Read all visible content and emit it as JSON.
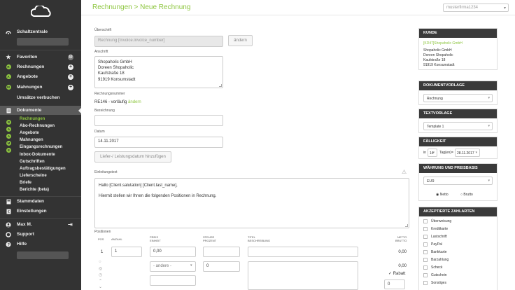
{
  "sidebar": {
    "main": "Schaltzentrale",
    "favorites": "Favoriten",
    "invoices": "Rechnungen",
    "offers": "Angebote",
    "reminders": "Mahnungen",
    "post_revenue": "Umsätze verbuchen",
    "documents": "Dokumente",
    "doc_items": [
      "Rechnungen",
      "Abo-Rechnungen",
      "Angebote",
      "Mahnungen",
      "Eingangsrechnungen",
      "Inbox-Dokumente",
      "Gutschriften",
      "Auftragsbestätigungen",
      "Lieferscheine",
      "Briefe",
      "Berichte (beta)"
    ],
    "master_data": "Stammdaten",
    "settings": "Einstellungen",
    "user": "Max M.",
    "support": "Support",
    "help": "Hilfe"
  },
  "header": {
    "title": "Rechnungen > Neue Rechnung",
    "account": "musterfirma1234"
  },
  "form": {
    "subject_label": "Überschrift",
    "subject_value": "Rechnung [Invoice.invoice_number]",
    "change_btn": "ändern",
    "address_label": "Anschrift",
    "address_lines": [
      "Shopaholic GmbH",
      "Doreen Shopaholic",
      "Kaufstraße 18",
      "91919 Konsumstadt"
    ],
    "invoice_number_label": "Rechnungsnummer",
    "invoice_number_value": "RE146 - vorläufig",
    "invoice_number_change": "ändern",
    "designation_label": "Bezeichnung",
    "date_label": "Datum",
    "date_value": "14.11.2017",
    "delivery_btn": "Liefer-/ Leistungsdatum hinzufügen",
    "intro_label": "Einleitungstext",
    "intro_text": [
      "Hallo [Client.salutation] [Client.last_name],",
      "Hiermit stellen wir Ihnen die folgenden Positionen in Rechnung."
    ]
  },
  "positions": {
    "label": "Positionen",
    "headers": {
      "pos": "POS",
      "qty": "ANZAHL",
      "price": [
        "PREIS",
        "EINHEIT"
      ],
      "tax": [
        "STEUER",
        "PROZENT"
      ],
      "title": [
        "TITEL",
        "BESCHREIBUNG"
      ],
      "net": [
        "NETTO",
        "BRUTTO"
      ]
    },
    "row": {
      "pos": "1",
      "qty": "1",
      "price": "0,00",
      "unit": "- andere -",
      "tax": "0",
      "net": "0,00",
      "gross": "0,00",
      "discount_label": "Rabatt",
      "discount_value": "0"
    }
  },
  "panels": {
    "customer": {
      "title": "KUNDE",
      "link": "[KD47]Shopaholic GmbH",
      "lines": [
        "Shopaholic GmbH",
        "Doreen Shopaholic",
        "Kaufstraße 18",
        "91919 Konsumstadt"
      ]
    },
    "doc_template": {
      "title": "DOKUMENTVORLAGE",
      "value": "Rechnung"
    },
    "text_template": {
      "title": "TEXTVORLAGE",
      "value": "Template 1"
    },
    "due": {
      "title": "FÄLLIGKEIT",
      "prefix": "in",
      "days": "14",
      "unit": "Tag(en)",
      "equals": "=",
      "date": "28.11.2017"
    },
    "currency": {
      "title": "WÄHRUNG UND PREISBASIS",
      "value": "EUR",
      "net": "Netto",
      "gross": "Brutto"
    },
    "payments": {
      "title": "AKZEPTIERTE ZAHLARTEN",
      "items": [
        "Überweisung",
        "Kreditkarte",
        "Lastschrift",
        "PayPal",
        "Bankkarte",
        "Barzahlung",
        "Scheck",
        "Gutschein",
        "Sonstiges"
      ]
    }
  },
  "colors": {
    "accent": "#8dc63f",
    "sidebar_bg": "#333333",
    "panel_head": "#3a3a3a"
  }
}
